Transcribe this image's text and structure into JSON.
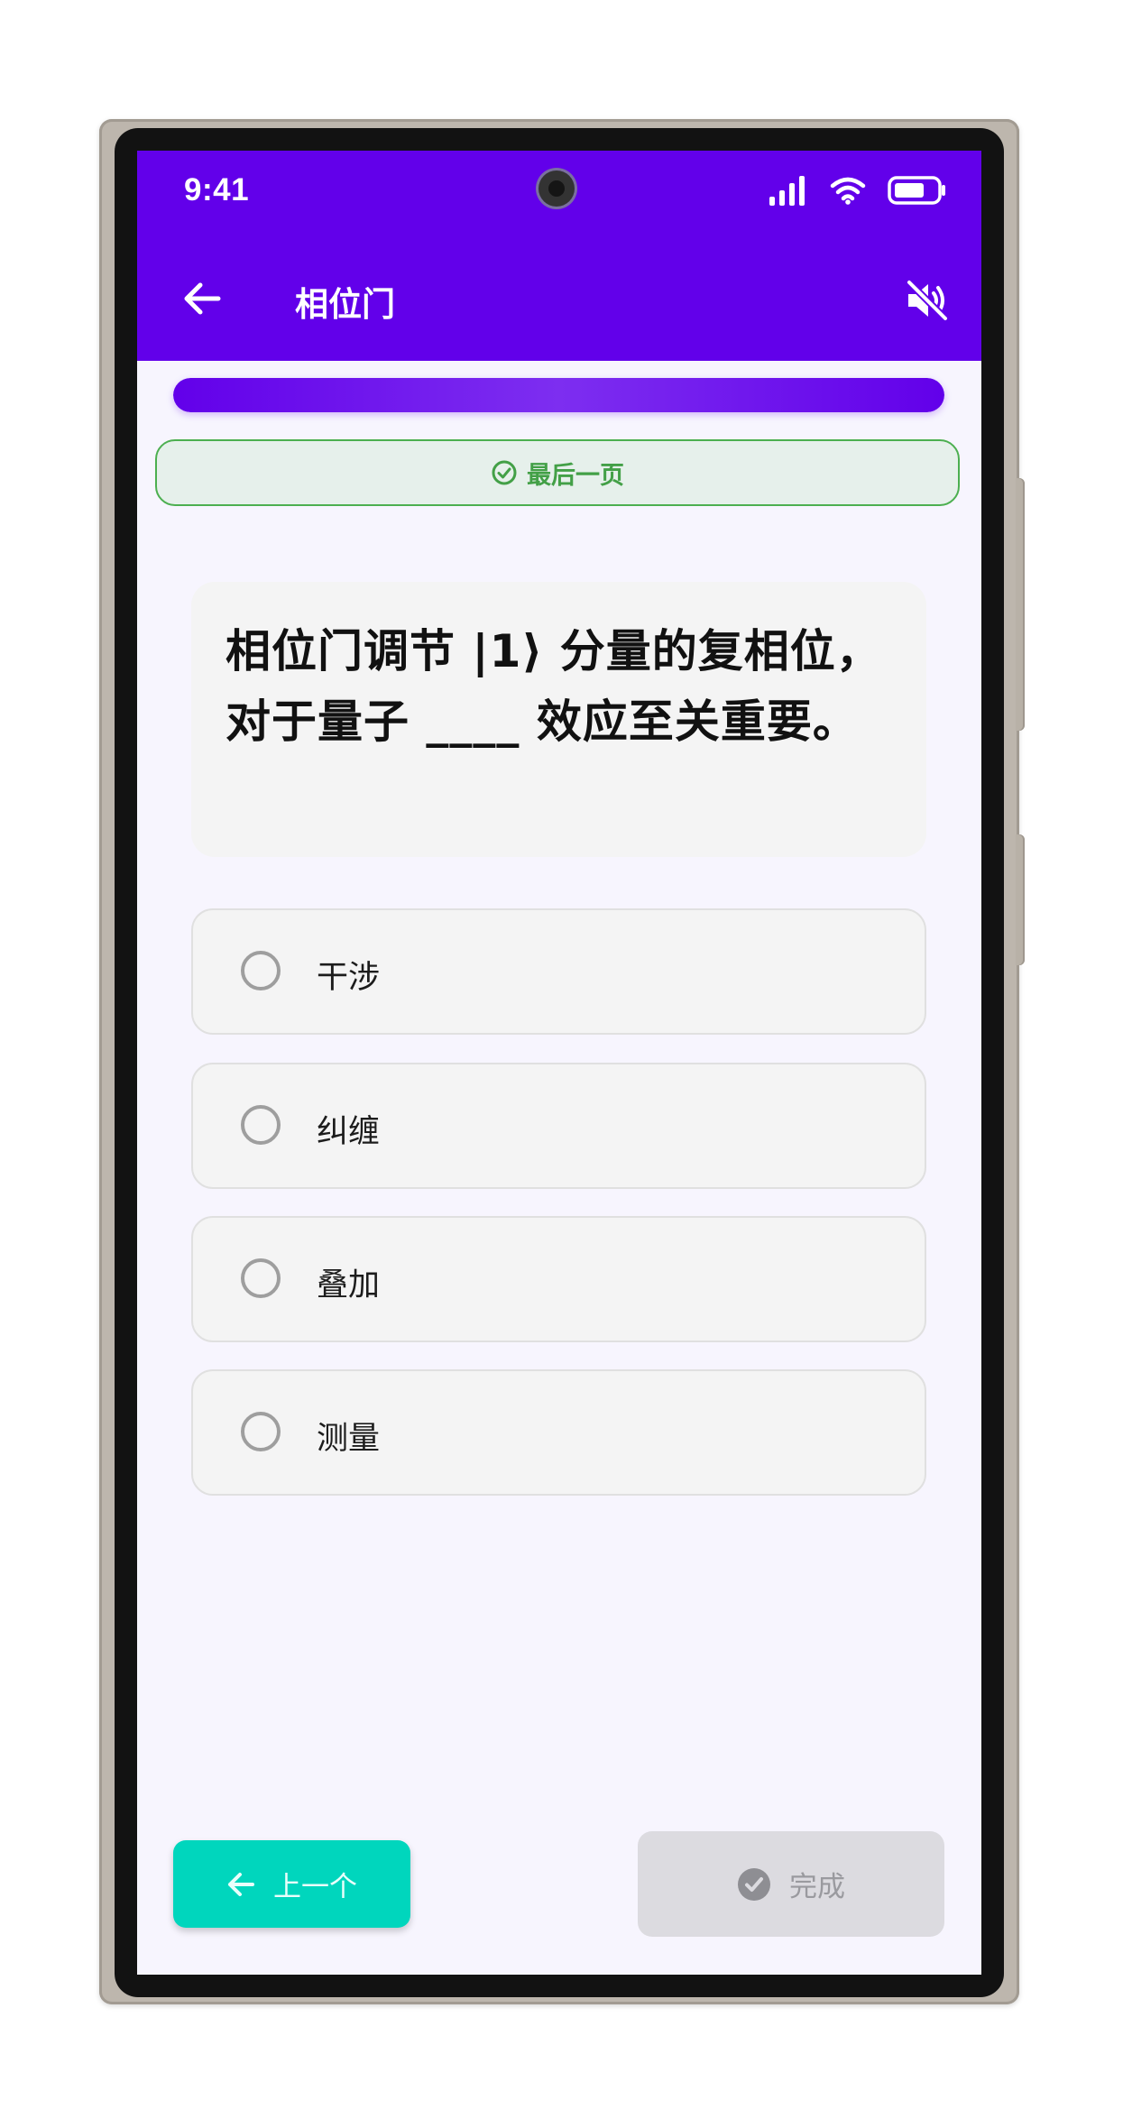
{
  "status_bar": {
    "time": "9:41",
    "icons": [
      "signal-icon",
      "wifi-icon",
      "battery-icon"
    ]
  },
  "header": {
    "back_icon": "arrow-left-icon",
    "title": "相位门",
    "mute_icon": "volume-mute-icon",
    "background_color": "#6200ea"
  },
  "progress": {
    "fraction": 1.0
  },
  "badge": {
    "icon": "check-circle-icon",
    "label": "最后一页",
    "color": "#43a047"
  },
  "question": {
    "text": "相位门调节 |1⟩ 分量的复相位，对于量子 ____ 效应至关重要。"
  },
  "options": [
    {
      "label": "干涉",
      "selected": false
    },
    {
      "label": "纠缠",
      "selected": false
    },
    {
      "label": "叠加",
      "selected": false
    },
    {
      "label": "测量",
      "selected": false
    }
  ],
  "footer": {
    "prev_label": "上一个",
    "prev_icon": "arrow-left-icon",
    "finish_label": "完成",
    "finish_icon": "check-circle-filled-icon",
    "finish_enabled": false,
    "accent_color": "#00d6bd"
  }
}
